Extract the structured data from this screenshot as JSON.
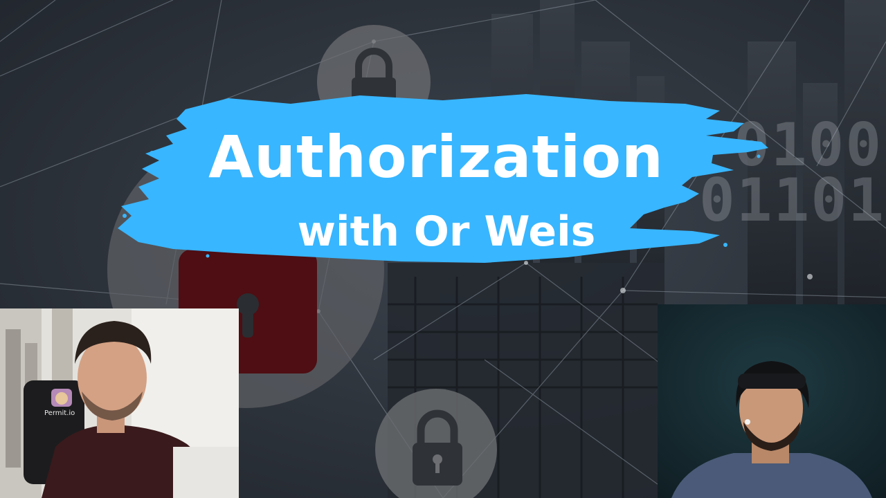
{
  "title": {
    "line1": "Authorization",
    "line2": "with Or Weis"
  },
  "background": {
    "binary_row1": "0100",
    "binary_row2": "01101",
    "icons": [
      "lock-icon",
      "lock-icon",
      "lock-icon-large"
    ]
  },
  "participants": {
    "left": {
      "chair_logo_text": "Permit.io"
    },
    "right": {}
  },
  "colors": {
    "brush": "#38b6ff",
    "title_text": "#ffffff",
    "background": "#2a2f36",
    "lock_red": "#6b1218"
  }
}
